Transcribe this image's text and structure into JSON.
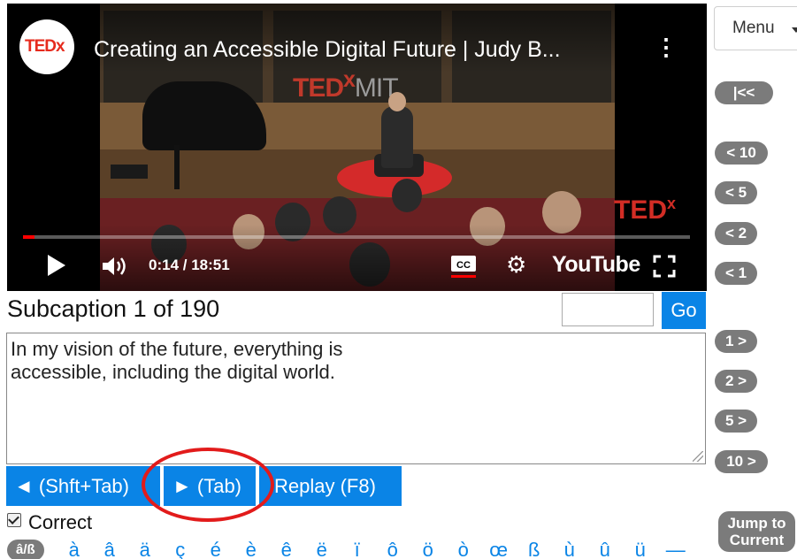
{
  "video": {
    "channel_logo_text": "TEDx",
    "title": "Creating an Accessible Digital Future | Judy B...",
    "scene_logo_main": "TED",
    "scene_logo_sup": "x",
    "scene_logo_suffix": "MIT",
    "side_logo_text": "TED",
    "side_logo_sup": "x",
    "time_display": "0:14 / 18:51",
    "progress_fraction": 0.017,
    "cc_label": "CC",
    "youtube_label": "YouTube",
    "icons": [
      "play-icon",
      "volume-icon",
      "closed-captions-icon",
      "settings-gear-icon",
      "fullscreen-icon",
      "more-options-icon"
    ]
  },
  "menu": {
    "label": "Menu"
  },
  "skip": {
    "first": "|<<",
    "back": [
      "< 10",
      "< 5",
      "< 2",
      "< 1"
    ],
    "forward": [
      "1 >",
      "2 >",
      "5 >",
      "10 >"
    ],
    "jump_line1": "Jump to",
    "jump_line2": "Current"
  },
  "editor": {
    "subcaption_label": "Subcaption 1 of 190",
    "goto_value": "",
    "go_label": "Go",
    "caption_line1": "In my vision of the future, everything is",
    "caption_line2": "accessible, including the digital world."
  },
  "nav": {
    "prev_label": "◄ (Shft+Tab)",
    "next_label": "► (Tab)",
    "replay_label": "Replay (F8)"
  },
  "correct": {
    "label": "Correct",
    "checked": true
  },
  "special_chars": {
    "toggle_label": "â/ß",
    "chars": [
      "à",
      "â",
      "ä",
      "ç",
      "é",
      "è",
      "ê",
      "ë",
      "ï",
      "ô",
      "ö",
      "ò",
      "œ",
      "ß",
      "ù",
      "û",
      "ü",
      "—"
    ]
  },
  "colors": {
    "accent": "#0a84e6",
    "pill": "#7b7b7b",
    "highlight": "#e21b1b",
    "youtube_red": "#ff0000"
  }
}
